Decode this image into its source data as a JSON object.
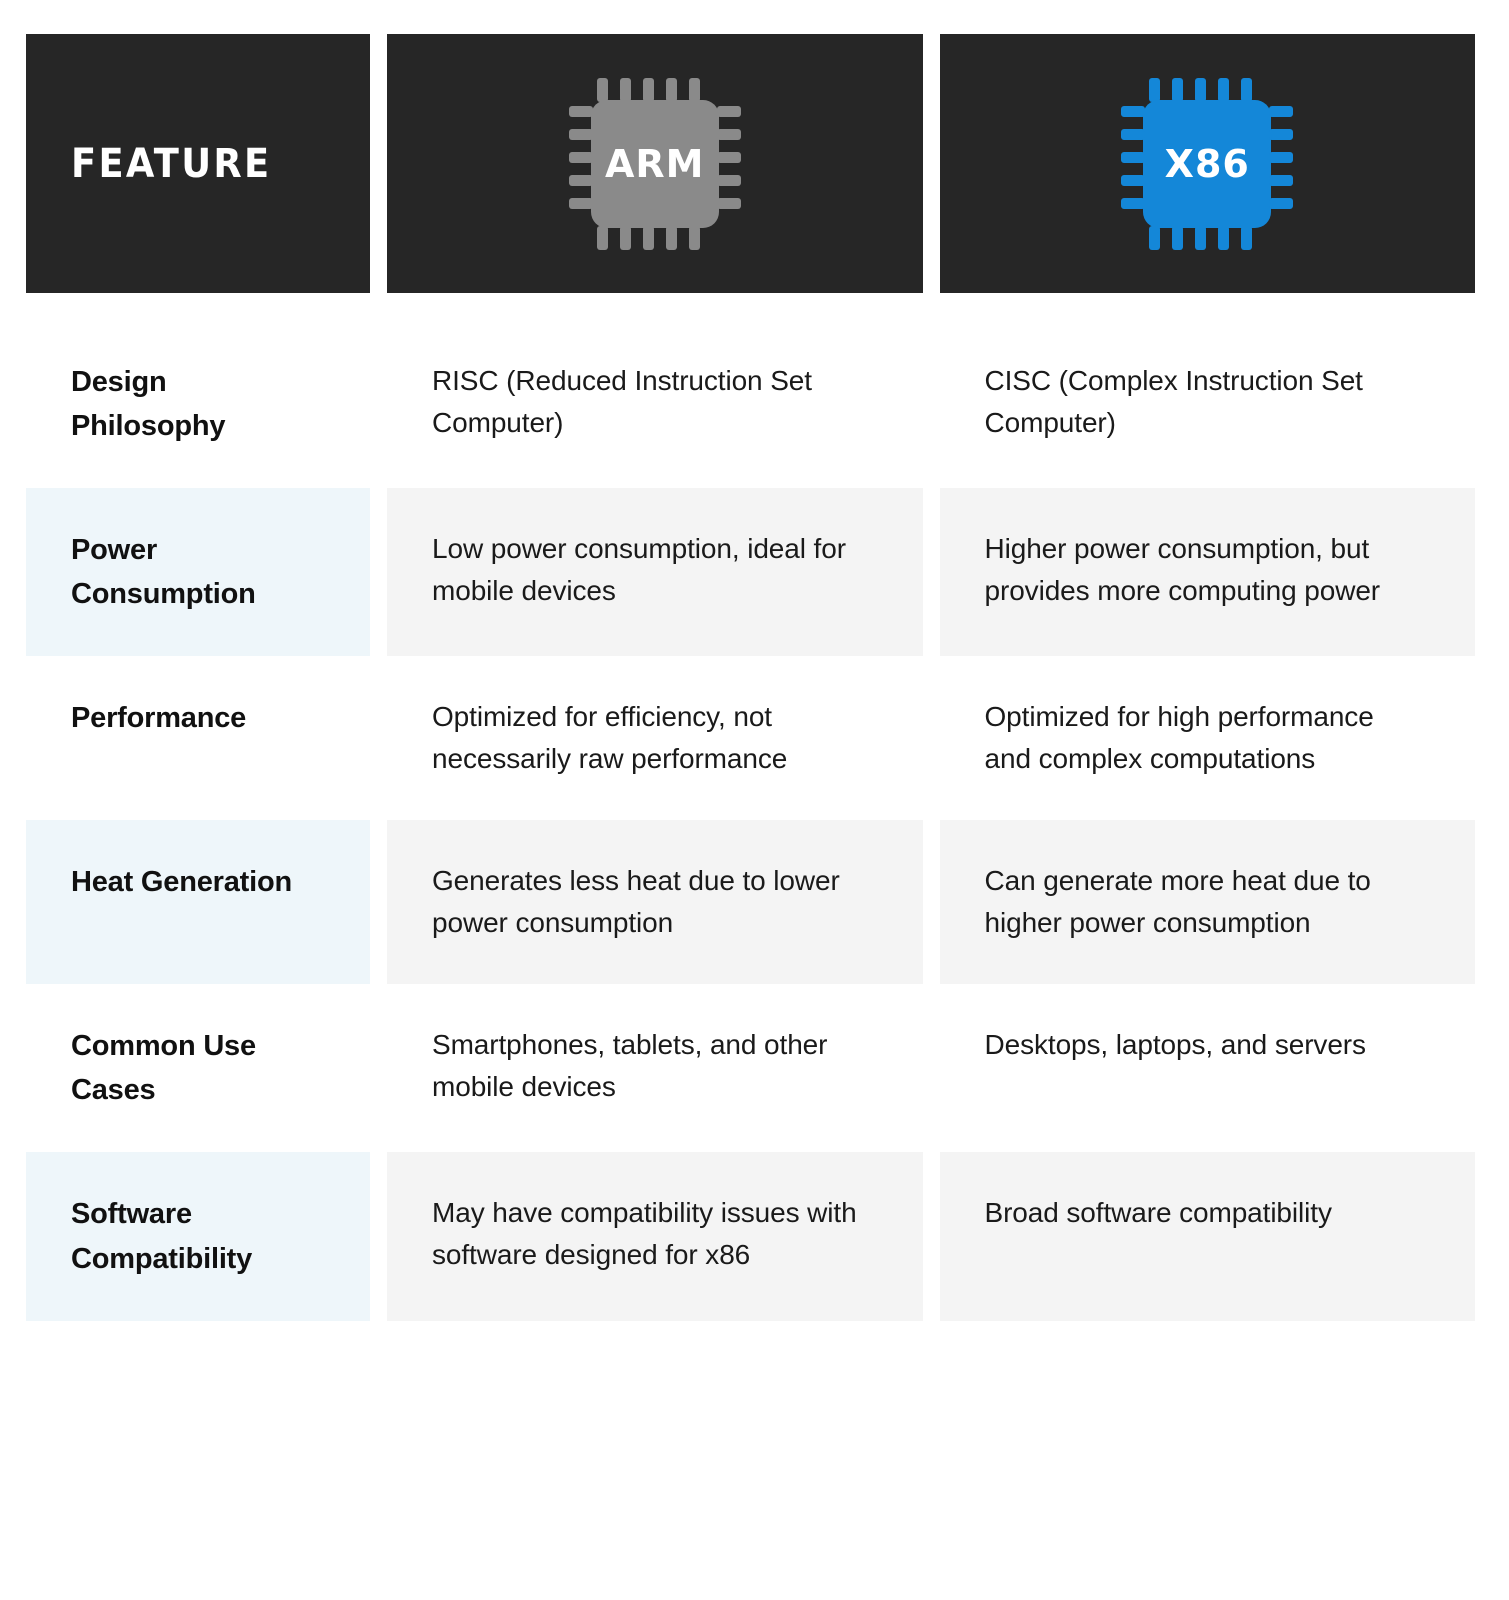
{
  "table": {
    "columns": [
      {
        "id": "feature",
        "label": "FEATURE",
        "type": "text-header"
      },
      {
        "id": "arm",
        "label": "ARM",
        "type": "chip-icon",
        "chip_color": "#8a8a8a"
      },
      {
        "id": "x86",
        "label": "X86",
        "type": "chip-icon",
        "chip_color": "#1487d8"
      }
    ],
    "header_background": "#262626",
    "shaded_feature_background": "#eef6fa",
    "shaded_value_background": "#f4f4f4",
    "rows": [
      {
        "shaded": false,
        "feature": "Design Philosophy",
        "arm": "RISC (Reduced Instruction Set Computer)",
        "x86": "CISC (Complex Instruction Set Computer)"
      },
      {
        "shaded": true,
        "feature": "Power Consumption",
        "arm": "Low power consumption, ideal for mobile devices",
        "x86": "Higher power consumption, but provides more computing power"
      },
      {
        "shaded": false,
        "feature": "Performance",
        "arm": "Optimized for efficiency, not necessarily raw performance",
        "x86": "Optimized for high performance and complex computations"
      },
      {
        "shaded": true,
        "feature": "Heat Generation",
        "arm": "Generates less heat due to lower power consumption",
        "x86": "Can generate more heat due to higher power consumption"
      },
      {
        "shaded": false,
        "feature": "Common Use Cases",
        "arm": "Smartphones, tablets, and other mobile devices",
        "x86": "Desktops, laptops, and servers"
      },
      {
        "shaded": true,
        "feature": "Software Compatibility",
        "arm": "May have compatibility issues with software designed for x86",
        "x86": "Broad software compatibility"
      }
    ]
  }
}
